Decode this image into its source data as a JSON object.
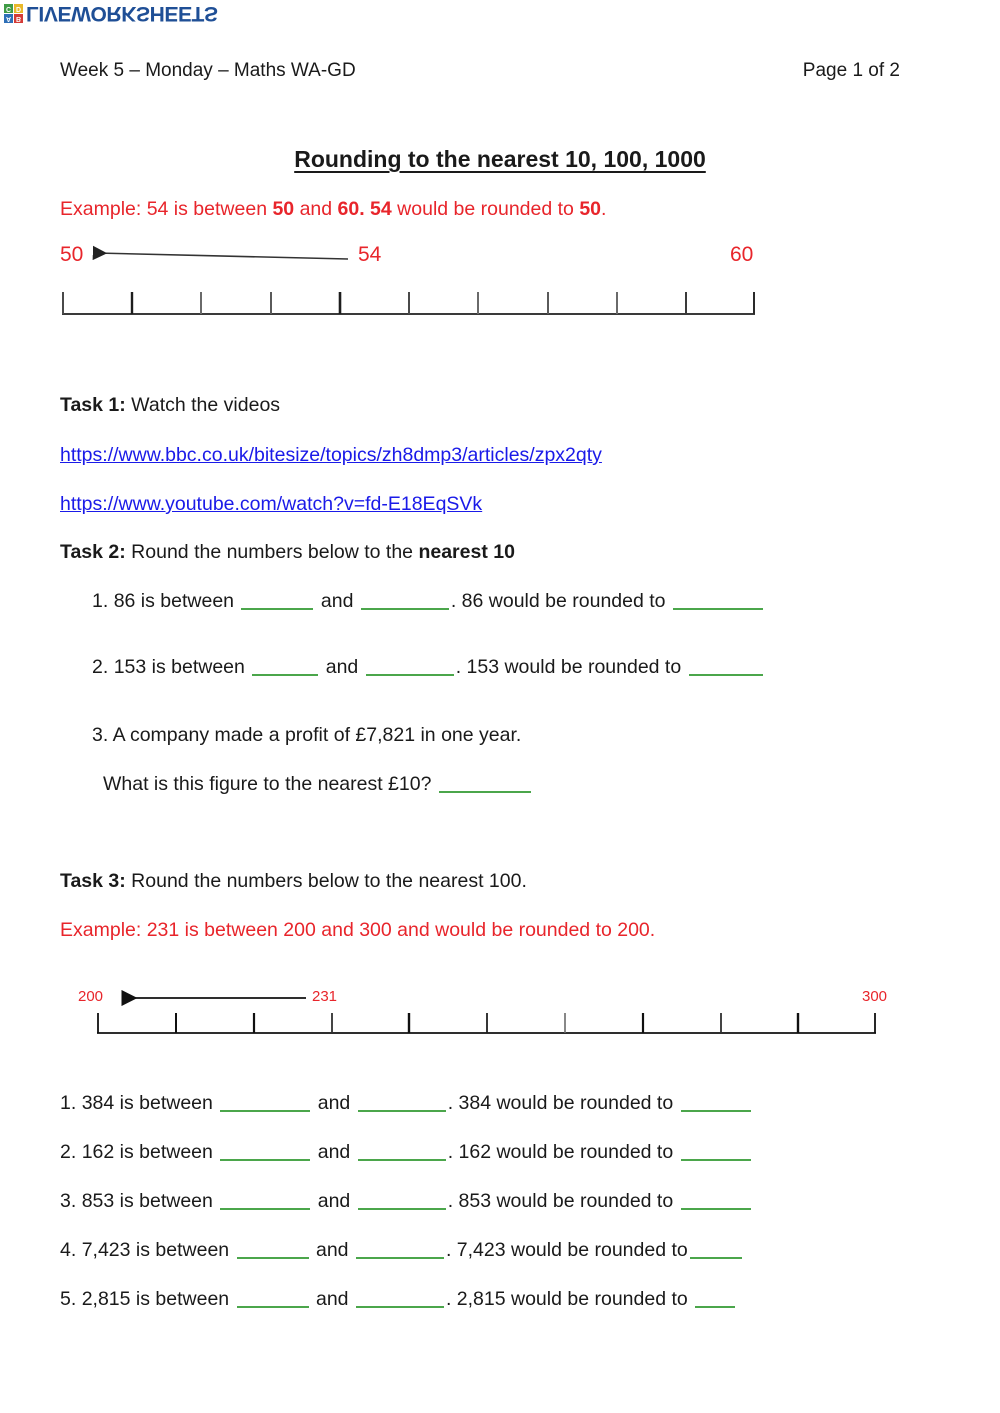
{
  "logo": {
    "squares": [
      {
        "letter": "A",
        "color": "#2e6fb7"
      },
      {
        "letter": "B",
        "color": "#d43b37"
      },
      {
        "letter": "C",
        "color": "#3f9b46"
      },
      {
        "letter": "D",
        "color": "#e8b82a"
      }
    ],
    "text": "LIVEWORKSHEETS"
  },
  "header": {
    "left": "Week 5 – Monday – Maths WA-GD",
    "right": "Page 1 of 2"
  },
  "title": "Rounding to the nearest 10, 100, 1000",
  "example1": {
    "prefix": "Example: 54 is between ",
    "low": "50",
    "mid": " and ",
    "high": "60. 54",
    "suffix": " would be rounded to ",
    "answer": "50",
    "period": "."
  },
  "numberline1": {
    "start_label": "50",
    "pointer_label": "54",
    "end_label": "60",
    "ticks": 11,
    "arrow_from_tick": 4,
    "arrow_to_tick": 0
  },
  "task1": {
    "label": "Task 1:",
    "text": " Watch the videos",
    "links": [
      "https://www.bbc.co.uk/bitesize/topics/zh8dmp3/articles/zpx2qty",
      "https://www.youtube.com/watch?v=fd-E18EqSVk"
    ]
  },
  "task2": {
    "label": "Task 2:",
    "text": " Round the numbers below to the ",
    "emphasis": "nearest 10",
    "questions": [
      {
        "number": "1.",
        "lead": "86 is between",
        "conj": "and",
        "tail": ". 86 would be rounded to",
        "blank1_width": 72,
        "blank2_width": 88,
        "blank3_width": 90,
        "answer1": "",
        "answer2": "",
        "answer3": ""
      },
      {
        "number": "2.",
        "lead": "153 is between",
        "conj": "and",
        "tail": ". 153 would be rounded to",
        "blank1_width": 66,
        "blank2_width": 88,
        "blank3_width": 74,
        "answer1": "",
        "answer2": "",
        "answer3": ""
      }
    ],
    "question3": {
      "number": "3.",
      "line1": "A company made a profit of £7,821 in one year.",
      "line2": "What is this figure to the nearest £10?",
      "blank_width": 92,
      "answer": ""
    }
  },
  "task3": {
    "label": "Task 3:",
    "text": " Round the numbers below to the nearest 100.",
    "example": "Example: 231 is between 200 and 300 and would be rounded to 200.",
    "numberline": {
      "start_label": "200",
      "pointer_label": "231",
      "end_label": "300",
      "ticks": 11,
      "arrow_from_tick": 3,
      "arrow_to_tick": 0
    },
    "questions": [
      {
        "number": "1.",
        "lead": "384 is between",
        "conj": "and",
        "tail": ". 384 would be rounded to",
        "blank1_width": 90,
        "blank2_width": 88,
        "blank3_width": 70,
        "answer1": "",
        "answer2": "",
        "answer3": ""
      },
      {
        "number": "2.",
        "lead": "162 is between",
        "conj": "and",
        "tail": ". 162 would be rounded to",
        "blank1_width": 90,
        "blank2_width": 88,
        "blank3_width": 70,
        "answer1": "",
        "answer2": "",
        "answer3": ""
      },
      {
        "number": "3.",
        "lead": "853 is between",
        "conj": "and",
        "tail": ". 853 would be rounded to",
        "blank1_width": 90,
        "blank2_width": 88,
        "blank3_width": 70,
        "answer1": "",
        "answer2": "",
        "answer3": ""
      },
      {
        "number": "4.",
        "lead": "7,423 is between",
        "conj": "and",
        "tail": ". 7,423 would be rounded to",
        "blank1_width": 72,
        "blank2_width": 88,
        "blank3_width": 52,
        "answer1": "",
        "answer2": "",
        "answer3": ""
      },
      {
        "number": "5.",
        "lead": "2,815 is between",
        "conj": "and",
        "tail": ". 2,815 would be rounded to",
        "blank1_width": 72,
        "blank2_width": 88,
        "blank3_width": 40,
        "answer1": "",
        "answer2": "",
        "answer3": ""
      }
    ]
  },
  "colors": {
    "red": "#e8252b",
    "green": "#4ba64b",
    "link": "#1a1ae8",
    "logo_blue": "#1f4f96"
  }
}
